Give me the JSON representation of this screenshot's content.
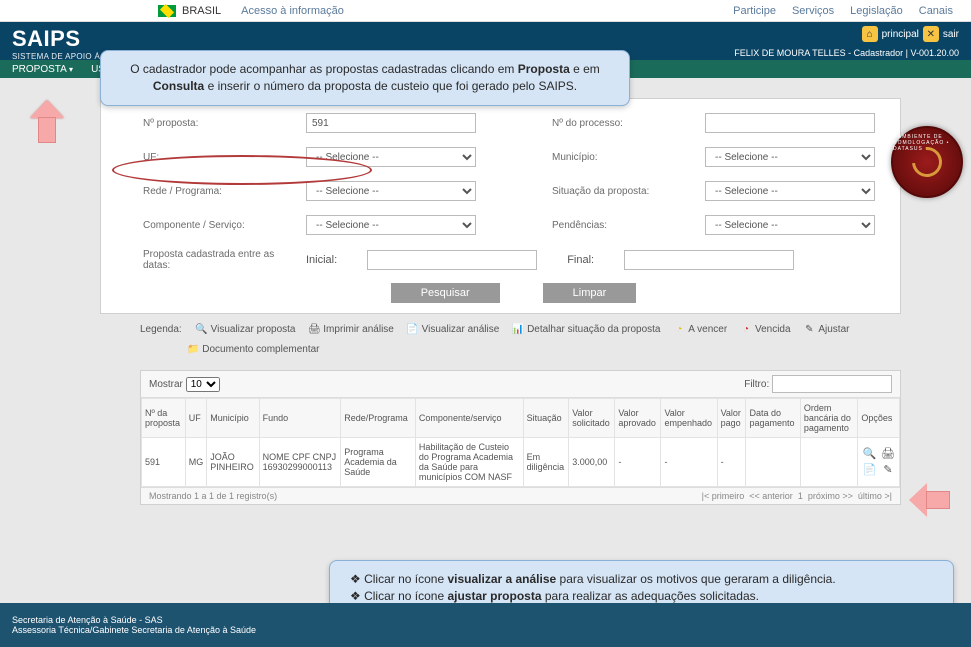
{
  "govbar": {
    "country": "BRASIL",
    "acesso": "Acesso à informação",
    "links": [
      "Participe",
      "Serviços",
      "Legislação",
      "Canais"
    ]
  },
  "header": {
    "title": "SAIPS",
    "subtitle": "SISTEMA DE APOIO À",
    "principal": "principal",
    "sair": "sair",
    "userline": "FELIX DE MOURA TELLES - Cadastrador   |   V-001.20.00"
  },
  "nav": {
    "proposta": "PROPOSTA",
    "usuario": "US"
  },
  "search": {
    "nproposta_label": "Nº proposta:",
    "nproposta_value": "591",
    "uf_label": "UF:",
    "selecione": "-- Selecione --",
    "rede_label": "Rede / Programa:",
    "comp_label": "Componente / Serviço:",
    "datas_label": "Proposta cadastrada entre as datas:",
    "inicial": "Inicial:",
    "final": "Final:",
    "nprocesso_label": "Nº do processo:",
    "municipio_label": "Município:",
    "situacao_label": "Situação da proposta:",
    "pendencias_label": "Pendências:",
    "pesquisar": "Pesquisar",
    "limpar": "Limpar"
  },
  "legend": {
    "label": "Legenda:",
    "items": [
      "Visualizar proposta",
      "Imprimir análise",
      "Visualizar análise",
      "Detalhar situação da proposta",
      "A vencer",
      "Vencida",
      "Ajustar",
      "Documento complementar"
    ]
  },
  "results": {
    "mostrar": "Mostrar",
    "mostrar_value": "10",
    "filtro": "Filtro:",
    "headers": [
      "Nº da proposta",
      "UF",
      "Município",
      "Fundo",
      "Rede/Programa",
      "Componente/serviço",
      "Situação",
      "Valor solicitado",
      "Valor aprovado",
      "Valor empenhado",
      "Valor pago",
      "Data do pagamento",
      "Ordem bancária do pagamento",
      "Opções"
    ],
    "row": {
      "num": "591",
      "uf": "MG",
      "municipio": "JOÃO PINHEIRO",
      "fundo": "NOME CPF CNPJ 16930299000113",
      "rede": "Programa Academia da Saúde",
      "componente": "Habilitação de Custeio do Programa Academia da Saúde para municípios COM NASF",
      "situacao": "Em diligência",
      "solicitado": "3.000,00",
      "aprovado": "-",
      "empenhado": "-",
      "pago": "-",
      "datapag": "",
      "ordem": ""
    },
    "footer_left": "Mostrando 1 a 1 de 1 registro(s)",
    "pager": [
      "|< primeiro",
      "<< anterior",
      "1",
      "próximo >>",
      "último >|"
    ]
  },
  "footer": {
    "line1": "Secretaria de Atenção à Saúde - SAS",
    "line2": "Assessoria Técnica/Gabinete Secretaria de Atenção à Saúde"
  },
  "callouts": {
    "top_before": "O cadastrador pode acompanhar as propostas cadastradas clicando em ",
    "top_b1": "Proposta",
    "top_mid": " e em ",
    "top_b2": "Consulta",
    "top_after": " e inserir o número da proposta de custeio que foi gerado pelo SAIPS.",
    "bot1_a": "Clicar no ícone ",
    "bot1_b": "visualizar a análise",
    "bot1_c": " para visualizar os motivos que geraram a diligência.",
    "bot2_a": "Clicar no ícone ",
    "bot2_b": "ajustar proposta",
    "bot2_c": " para realizar as adequações solicitadas."
  },
  "seal_text": "• AMBIENTE DE HOMOLOGAÇÃO • DATASUS"
}
